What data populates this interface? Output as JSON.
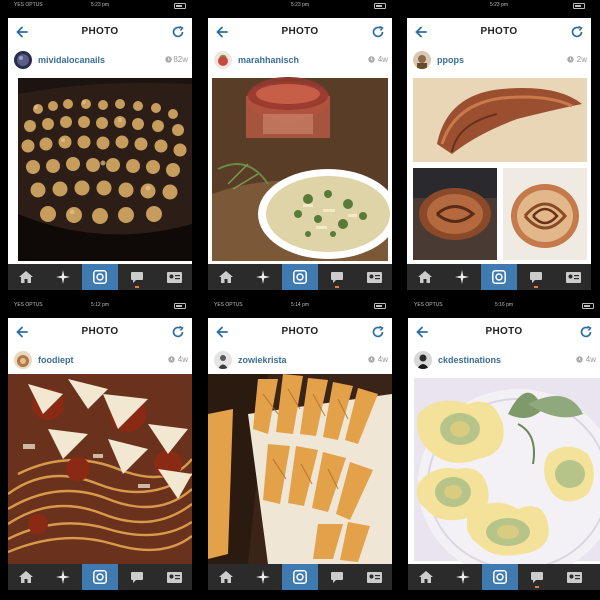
{
  "screens": [
    {
      "carrier": "YES OPTUS",
      "time": "5:23 pm",
      "title": "PHOTO",
      "username": "mividalocanails",
      "age": "82w"
    },
    {
      "carrier": "",
      "time": "5:23 pm",
      "title": "PHOTO",
      "username": "marahhanisch",
      "age": "4w"
    },
    {
      "carrier": "",
      "time": "5:23 pm",
      "title": "PHOTO",
      "username": "ppops",
      "age": "2w"
    },
    {
      "carrier": "YES OPTUS",
      "time": "5:12 pm",
      "title": "PHOTO",
      "username": "foodiept",
      "age": "4w"
    },
    {
      "carrier": "YES OPTUS",
      "time": "5:14 pm",
      "title": "PHOTO",
      "username": "zowiekrista",
      "age": "4w"
    },
    {
      "carrier": "YES OPTUS",
      "time": "5:16 pm",
      "title": "PHOTO",
      "username": "ckdestinations",
      "age": "4w"
    }
  ],
  "tabs": [
    "home-icon",
    "explore-icon",
    "camera-icon",
    "activity-icon",
    "profile-icon"
  ],
  "colors": {
    "accent": "#3f7bb0",
    "username": "#3b6e96",
    "tabbar": "#2b2b2b",
    "notification": "#e87a2e"
  }
}
